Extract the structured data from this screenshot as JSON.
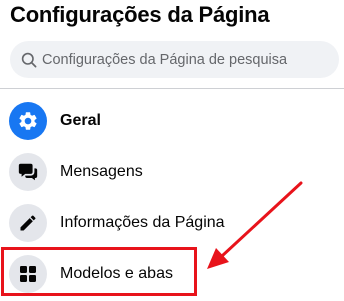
{
  "header": {
    "title": "Configurações da Página"
  },
  "search": {
    "placeholder": "Configurações da Página de pesquisa",
    "icon": "search-icon"
  },
  "nav": {
    "items": [
      {
        "label": "Geral",
        "icon": "gear-icon",
        "active": true
      },
      {
        "label": "Mensagens",
        "icon": "chat-bubbles-icon",
        "active": false
      },
      {
        "label": "Informações da Página",
        "icon": "pencil-icon",
        "active": false
      },
      {
        "label": "Modelos e abas",
        "icon": "grid-icon",
        "active": false
      }
    ]
  },
  "annotation": {
    "highlight_color": "#e8131b",
    "arrow_color": "#e8131b"
  },
  "colors": {
    "accent": "#1877f2",
    "icon_bg": "#e4e6eb",
    "search_bg": "#f0f2f5"
  }
}
